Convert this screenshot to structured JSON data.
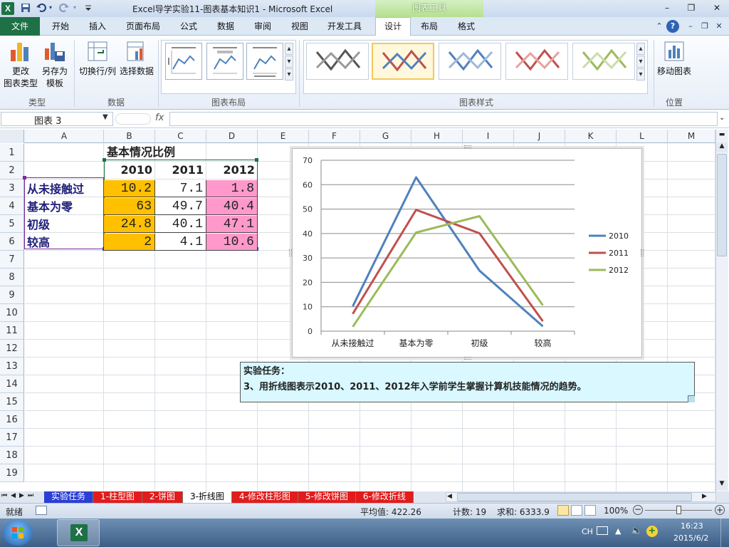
{
  "window": {
    "title": "Excel导学实验11-图表基本知识1  -  Microsoft Excel",
    "context_tab": "图表工具",
    "app_icon": "X"
  },
  "qat": {
    "save_icon": "save-icon",
    "undo_icon": "undo-icon",
    "redo_icon": "redo-icon",
    "customize_icon": "chevron-down-icon"
  },
  "window_controls": {
    "minimize": "–",
    "restore": "❐",
    "close": "✕"
  },
  "ribbon_tabs": {
    "file": "文件",
    "home": "开始",
    "insert": "插入",
    "page_layout": "页面布局",
    "formulas": "公式",
    "data": "数据",
    "review": "审阅",
    "view": "视图",
    "developer": "开发工具",
    "design": "设计",
    "layout": "布局",
    "format": "格式"
  },
  "ribbon": {
    "type_group": {
      "label": "类型",
      "change_type": "更改\n图表类型",
      "save_template": "另存为\n模板"
    },
    "data_group": {
      "label": "数据",
      "switch": "切换行/列",
      "select_data": "选择数据"
    },
    "layout_group": {
      "label": "图表布局"
    },
    "styles_group": {
      "label": "图表样式"
    },
    "location_group": {
      "label": "位置",
      "move_chart": "移动图表"
    }
  },
  "formula_bar": {
    "name_box": "图表 3",
    "fx": "fx",
    "formula": ""
  },
  "columns": [
    "A",
    "B",
    "C",
    "D",
    "E",
    "F",
    "G",
    "H",
    "I",
    "J",
    "K",
    "L",
    "M"
  ],
  "rows": [
    "1",
    "2",
    "3",
    "4",
    "5",
    "6",
    "7",
    "8",
    "9",
    "10",
    "11",
    "12",
    "13",
    "14",
    "15",
    "16",
    "17",
    "18",
    "19"
  ],
  "sheet": {
    "title": "基本情况比例",
    "years": [
      "2010",
      "2011",
      "2012"
    ],
    "data": [
      {
        "label": "从未接触过",
        "v2010": "10.2",
        "v2011": "7.1",
        "v2012": "1.8"
      },
      {
        "label": "基本为零",
        "v2010": "63",
        "v2011": "49.7",
        "v2012": "40.4"
      },
      {
        "label": "初级",
        "v2010": "24.8",
        "v2011": "40.1",
        "v2012": "47.1"
      },
      {
        "label": "较高",
        "v2010": "2",
        "v2011": "4.1",
        "v2012": "10.6"
      }
    ],
    "colors": {
      "col2010": "#ffc000",
      "col2011": "#ffffff",
      "col2012": "#ff99cc",
      "label": "#1f1f7a"
    }
  },
  "chart_data": {
    "type": "line",
    "categories": [
      "从未接触过",
      "基本为零",
      "初级",
      "较高"
    ],
    "series": [
      {
        "name": "2010",
        "values": [
          10.2,
          63,
          24.8,
          2
        ],
        "color": "#4f81bd"
      },
      {
        "name": "2011",
        "values": [
          7.1,
          49.7,
          40.1,
          4.1
        ],
        "color": "#c0504d"
      },
      {
        "name": "2012",
        "values": [
          1.8,
          40.4,
          47.1,
          10.6
        ],
        "color": "#9bbb59"
      }
    ],
    "ylim": [
      0,
      70
    ],
    "yticks": [
      "0",
      "10",
      "20",
      "30",
      "40",
      "50",
      "60",
      "70"
    ],
    "grid": true,
    "legend": "right"
  },
  "task_box": {
    "line1": "实验任务：",
    "line2": "3、用折线图表示2010、2011、2012年入学前学生掌握计算机技能情况的趋势。"
  },
  "sheet_tabs": [
    {
      "label": "实验任务",
      "color": "#2b3ed6",
      "text": "#ffffff"
    },
    {
      "label": "1-柱型图",
      "color": "#e21b1b",
      "text": "#ffffff"
    },
    {
      "label": "2-饼图",
      "color": "#e21b1b",
      "text": "#ffffff"
    },
    {
      "label": "3-折线图",
      "color": "#ffffff",
      "text": "#000000"
    },
    {
      "label": "4-修改柱形图",
      "color": "#e21b1b",
      "text": "#ffffff"
    },
    {
      "label": "5-修改饼图",
      "color": "#e21b1b",
      "text": "#ffffff"
    },
    {
      "label": "6-修改折线",
      "color": "#e21b1b",
      "text": "#ffffff"
    }
  ],
  "status": {
    "ready": "就绪",
    "average": "平均值: 422.26",
    "count": "计数: 19",
    "sum": "求和: 6333.9",
    "zoom": "100%"
  },
  "taskbar": {
    "lang": "CH",
    "time": "16:23",
    "date": "2015/6/2"
  }
}
